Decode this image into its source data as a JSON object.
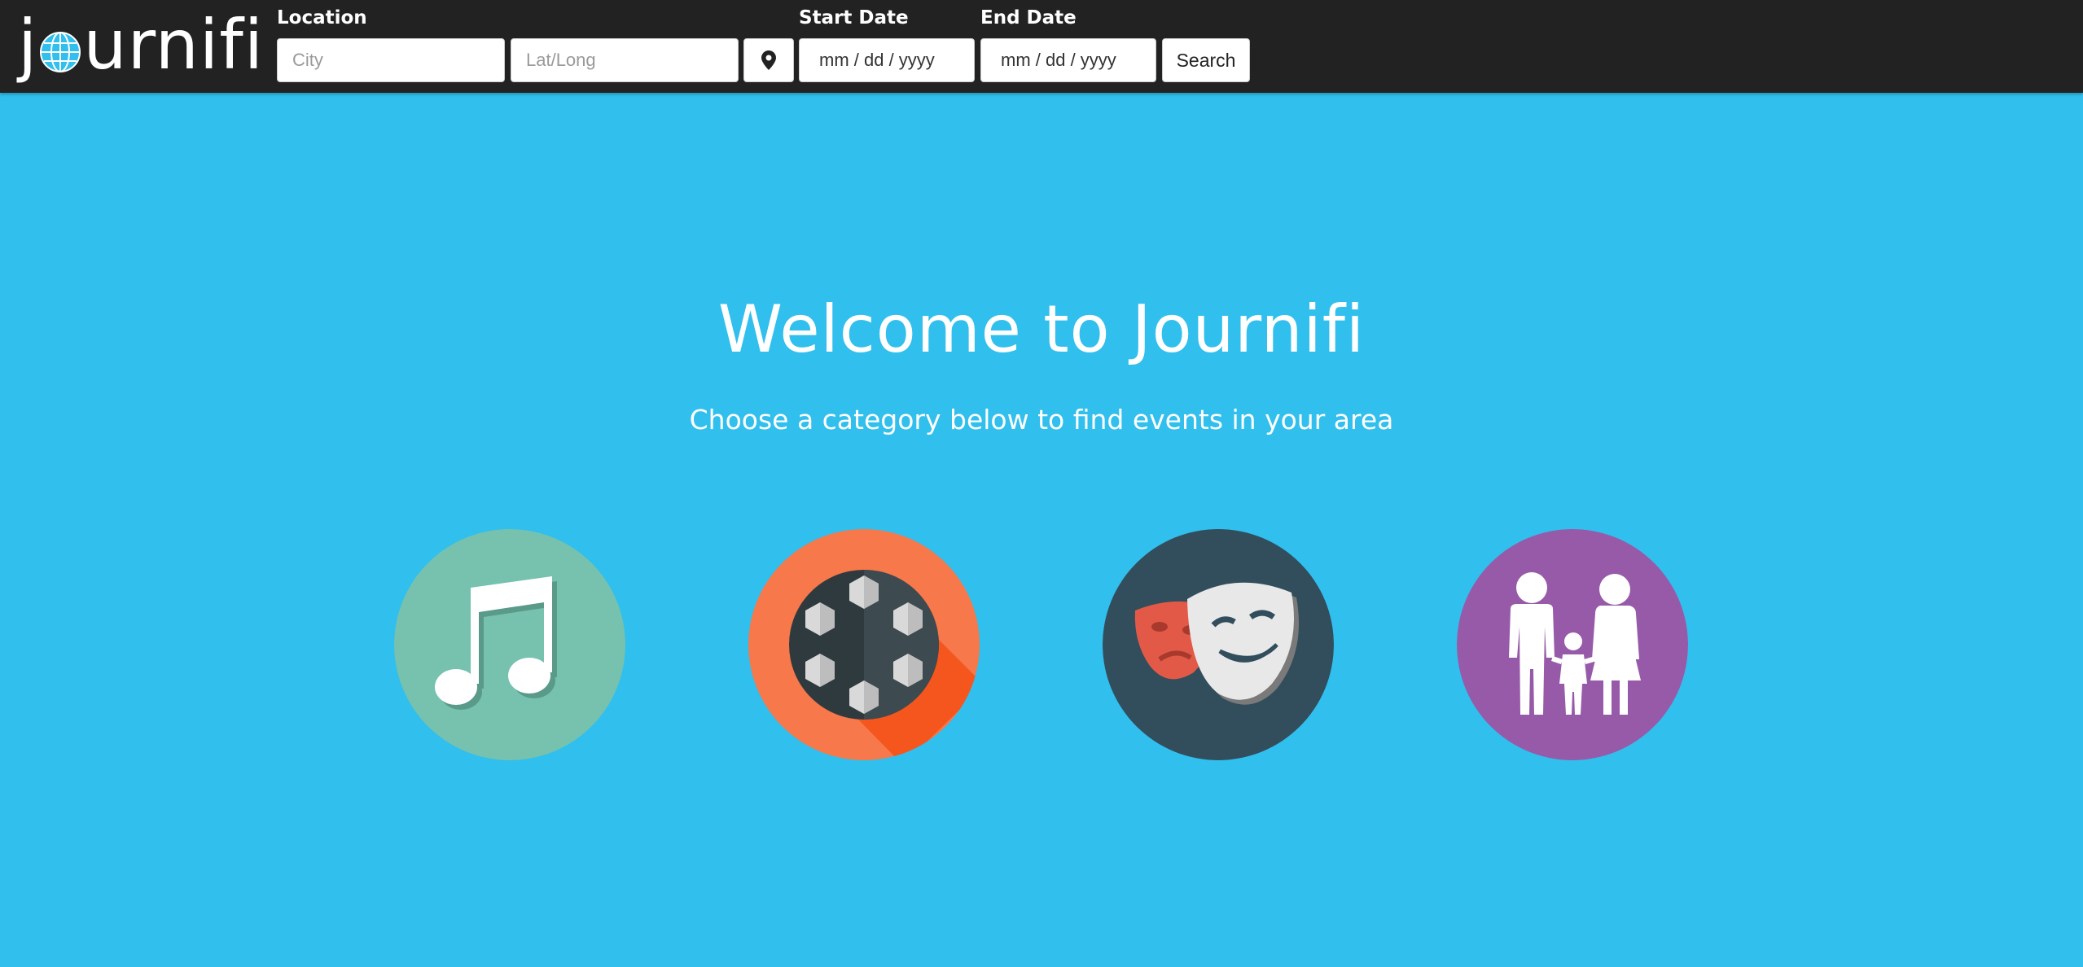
{
  "app": {
    "logo_before": "j",
    "logo_after": "urnifi"
  },
  "search": {
    "location_label": "Location",
    "city_placeholder": "City",
    "latlong_placeholder": "Lat/Long",
    "start_label": "Start Date",
    "start_value": "mm / dd / yyyy",
    "end_label": "End Date",
    "end_value": "mm / dd / yyyy",
    "search_label": "Search"
  },
  "hero": {
    "title": "Welcome to Journifi",
    "subtitle": "Choose a category below to find events in your area"
  },
  "categories": [
    {
      "icon": "music-note-icon",
      "color": "#76c2af"
    },
    {
      "icon": "soccer-ball-icon",
      "color": "#f7784a"
    },
    {
      "icon": "theater-masks-icon",
      "color": "#324d5c"
    },
    {
      "icon": "family-icon",
      "color": "#975aa8"
    }
  ],
  "colors": {
    "navbar": "#222222",
    "background": "#31bfed"
  }
}
